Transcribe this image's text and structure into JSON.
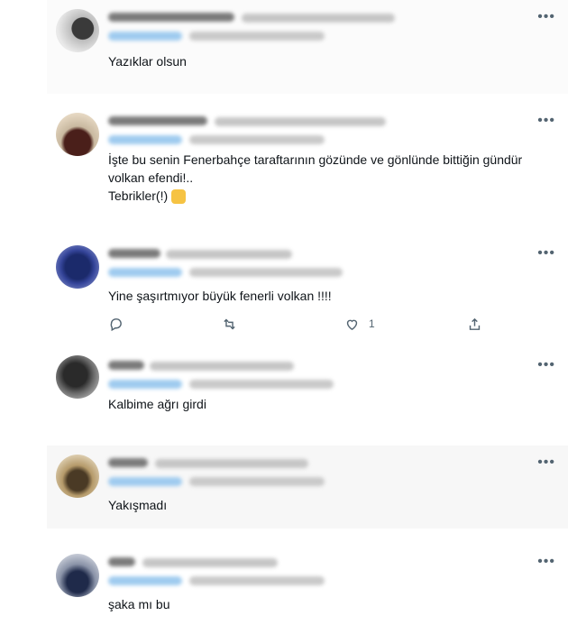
{
  "replies": [
    {
      "text_lines": [
        "Yazıklar olsun"
      ]
    },
    {
      "text_lines": [
        "İşte bu senin Fenerbahçe taraftarının gözünde ve gönlünde bittiğin gündür",
        "volkan efendi!..",
        "Tebrikler(!)"
      ],
      "emoji": "clapping-hands"
    },
    {
      "text_lines": [
        "Yine şaşırtmıyor büyük fenerli volkan !!!!"
      ],
      "like_count": "1"
    },
    {
      "text_lines": [
        "Kalbime ağrı girdi"
      ]
    },
    {
      "text_lines": [
        "Yakışmadı"
      ]
    },
    {
      "text_lines": [
        "şaka mı bu"
      ]
    }
  ],
  "ui": {
    "more_glyph": "•••",
    "icons": [
      "reply-icon",
      "retweet-icon",
      "like-icon",
      "share-icon",
      "more-icon"
    ],
    "colors": {
      "text": "#0f1419",
      "secondary": "#536471",
      "link": "#1d9bf0"
    }
  }
}
